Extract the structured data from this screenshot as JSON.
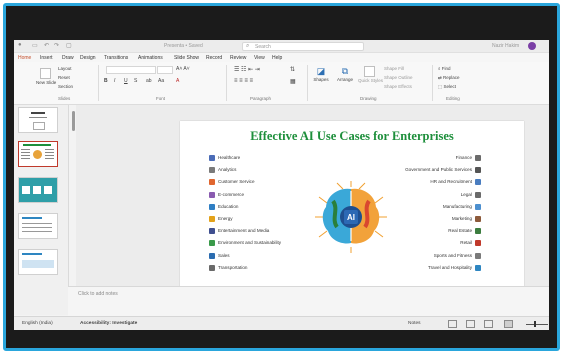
{
  "titlebar": {
    "doc_title": "Presenta • Saved",
    "search_placeholder": "Search",
    "user": "Nazir Hakim"
  },
  "tabs": [
    "Home",
    "Insert",
    "Draw",
    "Design",
    "Transitions",
    "Animations",
    "Slide Show",
    "Record",
    "Review",
    "View",
    "Help"
  ],
  "ribbon": {
    "new_slide": "New Slide",
    "layout": "Layout",
    "reset": "Reset",
    "section": "Section",
    "slides_group": "Slides",
    "font_group": "Font",
    "paragraph_group": "Paragraph",
    "shapes": "Shapes",
    "arrange": "Arrange",
    "quick_styles": "Quick Styles",
    "shape_fill": "Shape Fill",
    "shape_outline": "Shape Outline",
    "shape_effects": "Shape Effects",
    "drawing_group": "Drawing",
    "find": "Find",
    "replace": "Replace",
    "select": "Select",
    "editing_group": "Editing"
  },
  "slide": {
    "title": "Effective AI Use Cases for Enterprises",
    "center_label": "AI",
    "left_items": [
      {
        "label": "Healthcare",
        "icon": "healthcare-icon",
        "color": "#4b6cb7"
      },
      {
        "label": "Analytics",
        "icon": "analytics-icon",
        "color": "#7a7a7a"
      },
      {
        "label": "Customer Service",
        "icon": "customer-service-icon",
        "color": "#e0662f"
      },
      {
        "label": "E-commerce",
        "icon": "ecommerce-icon",
        "color": "#8a5bb0"
      },
      {
        "label": "Education",
        "icon": "education-icon",
        "color": "#2f7fc4"
      },
      {
        "label": "Energy",
        "icon": "energy-icon",
        "color": "#e3a21a"
      },
      {
        "label": "Entertainment and Media",
        "icon": "media-icon",
        "color": "#3f4f8f"
      },
      {
        "label": "Environment and Sustainability",
        "icon": "environment-icon",
        "color": "#3a9a4a"
      },
      {
        "label": "Sales",
        "icon": "sales-icon",
        "color": "#2b6cb0"
      },
      {
        "label": "Transportation",
        "icon": "transportation-icon",
        "color": "#6a6a6a"
      }
    ],
    "right_items": [
      {
        "label": "Finance",
        "icon": "finance-icon",
        "color": "#6b6b6b"
      },
      {
        "label": "Government and Public Services",
        "icon": "government-icon",
        "color": "#555555"
      },
      {
        "label": "HR and Recruitment",
        "icon": "hr-icon",
        "color": "#4a7dc0"
      },
      {
        "label": "Legal",
        "icon": "legal-icon",
        "color": "#6a6a6a"
      },
      {
        "label": "Manufacturing",
        "icon": "manufacturing-icon",
        "color": "#4c8fcf"
      },
      {
        "label": "Marketing",
        "icon": "marketing-icon",
        "color": "#8d5a3b"
      },
      {
        "label": "Real Estate",
        "icon": "real-estate-icon",
        "color": "#3c7d3f"
      },
      {
        "label": "Retail",
        "icon": "retail-icon",
        "color": "#c0392b"
      },
      {
        "label": "Sports and Fitness",
        "icon": "sports-icon",
        "color": "#7a7a7a"
      },
      {
        "label": "Travel and Hospitality",
        "icon": "travel-icon",
        "color": "#2e86c1"
      }
    ]
  },
  "thumbnails": [
    {
      "number": "",
      "selected": false
    },
    {
      "number": "",
      "selected": true
    },
    {
      "number": "",
      "selected": false
    },
    {
      "number": "",
      "selected": false
    },
    {
      "number": "",
      "selected": false
    }
  ],
  "notes_placeholder": "Click to add notes",
  "statusbar": {
    "language": "English (India)",
    "accessibility": "Accessibility: Investigate",
    "notes": "Notes"
  },
  "colors": {
    "accent": "#c4502d",
    "title_green": "#1d8f3b",
    "frame_blue": "#2aa6dc"
  }
}
